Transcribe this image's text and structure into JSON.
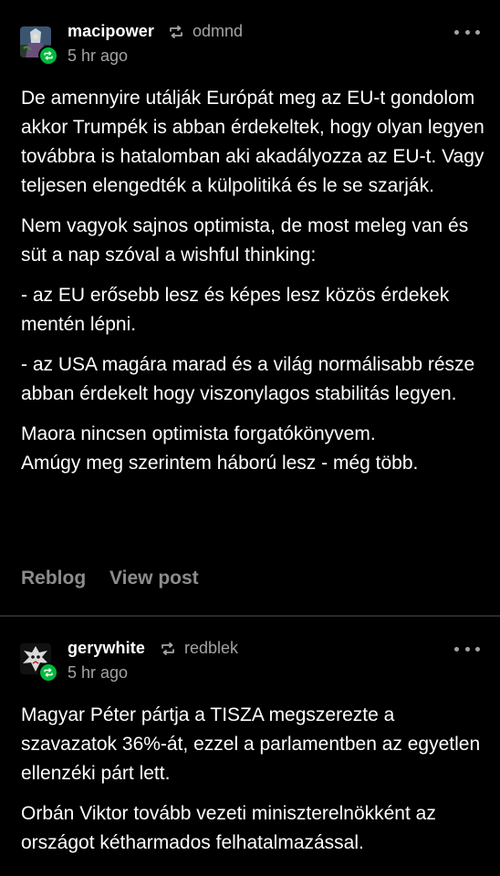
{
  "posts": [
    {
      "username": "macipower",
      "via": "odmnd",
      "time": "5 hr ago",
      "paragraphs": [
        "De amennyire utálják Európát meg az EU-t gondolom akkor Trumpék is abban érdekeltek, hogy olyan legyen továbbra is hatalomban aki akadályozza az EU-t. Vagy teljesen elengedték a külpolitiká és le se szarják.",
        "Nem vagyok sajnos optimista, de most meleg van és süt a nap szóval a wishful thinking:",
        "- az EU erősebb lesz és képes lesz közös érdekek mentén lépni.",
        "- az USA magára marad és a világ normálisabb része abban érdekelt hogy viszonylagos stabilitás legyen.",
        "Maora nincsen optimista forgatókönyvem.",
        "Amúgy meg szerintem háború lesz - még több."
      ],
      "actions": {
        "reblog": "Reblog",
        "view_post": "View post"
      }
    },
    {
      "username": "gerywhite",
      "via": "redblek",
      "time": "5 hr ago",
      "paragraphs": [
        "Magyar Péter pártja a TISZA megszerezte a szavazatok 36%-át, ezzel a parlamentben az egyetlen ellenzéki párt lett.",
        "Orbán Viktor tovább vezeti miniszterelnökként az országot kétharmados felhatalmazással."
      ]
    }
  ],
  "icons": {
    "reblog": "reblog-icon",
    "more": "more-options-icon"
  },
  "colors": {
    "background": "#000000",
    "text": "#ffffff",
    "muted": "#a3a3a3",
    "action": "#8c8c8c",
    "badge": "#00b83d"
  }
}
